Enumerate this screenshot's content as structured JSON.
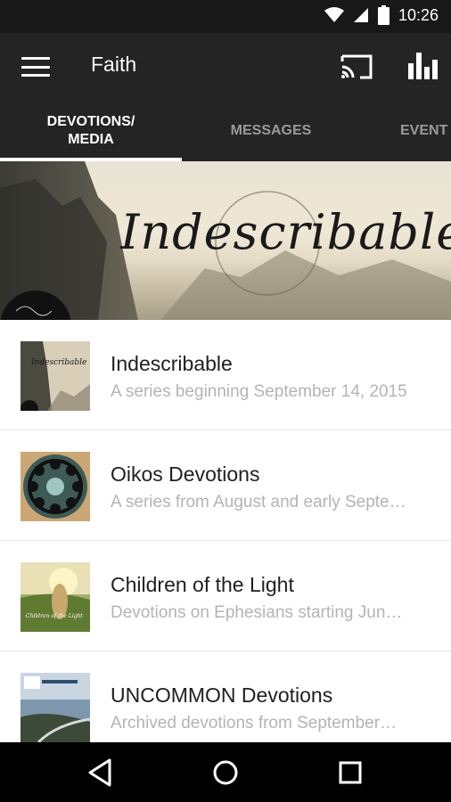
{
  "status_bar": {
    "time": "10:26",
    "icons": [
      "wifi-icon",
      "signal-icon",
      "battery-icon"
    ]
  },
  "app_bar": {
    "title": "Faith",
    "icons": [
      "menu-icon",
      "cast-icon",
      "bar-chart-icon"
    ]
  },
  "tabs": [
    {
      "label_line1": "DEVOTIONS/",
      "label_line2": "MEDIA",
      "active": true
    },
    {
      "label": "MESSAGES",
      "active": false
    },
    {
      "label": "EVENT",
      "active": false
    }
  ],
  "banner": {
    "title": "Indescribable"
  },
  "list": [
    {
      "title": "Indescribable",
      "subtitle": "A series beginning September 14, 2015",
      "thumb_label": "Indescribable"
    },
    {
      "title": "Oikos Devotions",
      "subtitle": "A series from August and early Septe…",
      "thumb_label": ""
    },
    {
      "title": "Children of the Light",
      "subtitle": "Devotions on Ephesians starting Jun…",
      "thumb_label": "Children of the Light"
    },
    {
      "title": "UNCOMMON Devotions",
      "subtitle": "Archived devotions from September…",
      "thumb_label": ""
    }
  ],
  "nav_bar": {
    "icons": [
      "back-icon",
      "home-icon",
      "recents-icon"
    ]
  },
  "colors": {
    "app_bar": "#242424",
    "status_bar": "#181818",
    "tab_active": "#ffffff",
    "tab_inactive": "#9a9a9a",
    "subtitle": "#b4b4b4"
  }
}
